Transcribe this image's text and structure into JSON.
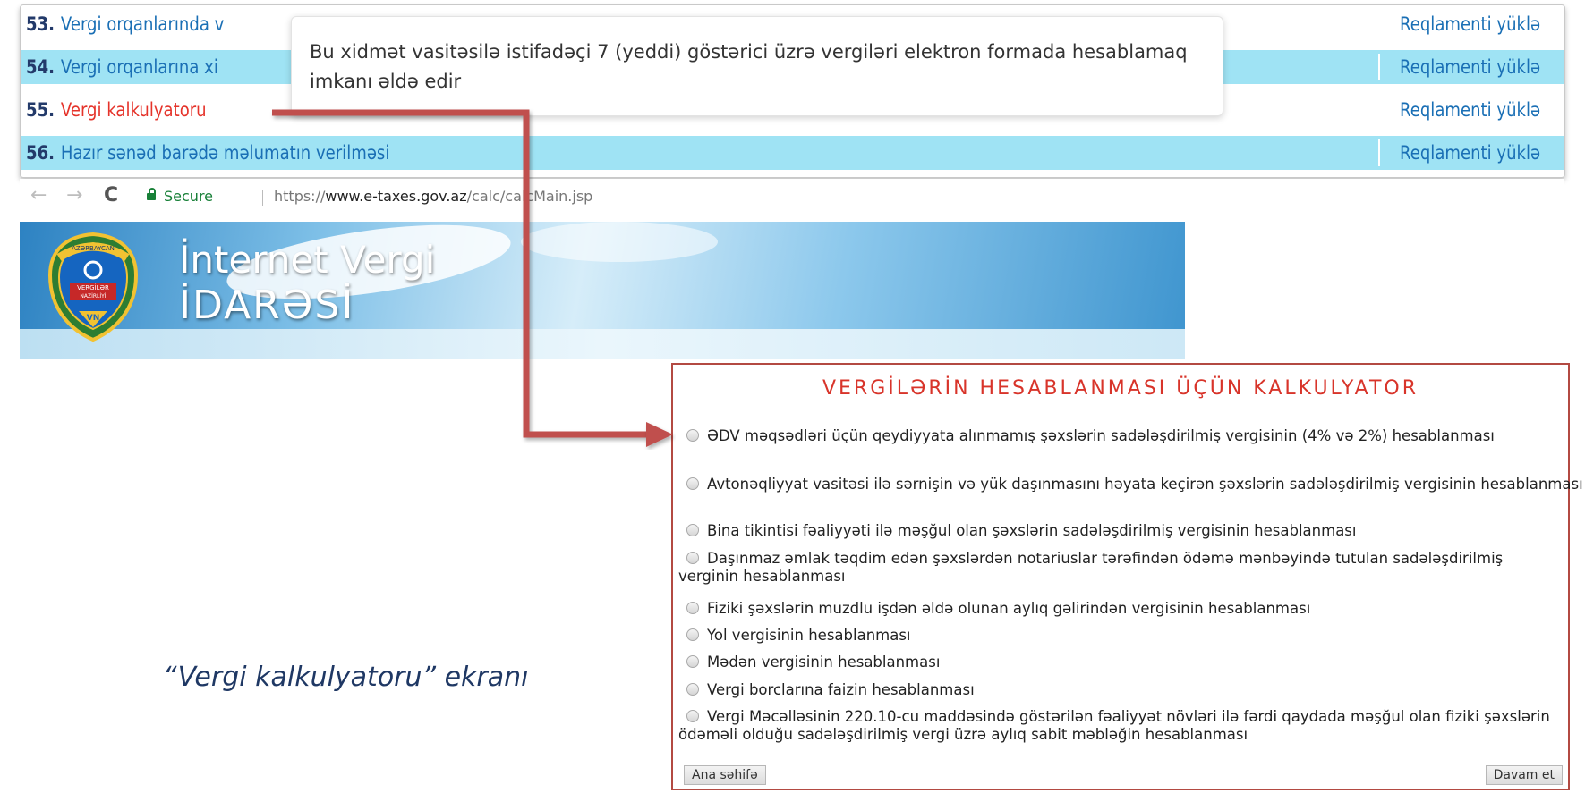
{
  "services": [
    {
      "number": "53.",
      "title": "Vergi orqanlarında v",
      "link": "Reqlamenti yüklə"
    },
    {
      "number": "54.",
      "title": "Vergi orqanlarına xi",
      "link": "Reqlamenti yüklə"
    },
    {
      "number": "55.",
      "title": "Vergi kalkulyatoru",
      "link": "Reqlamenti yüklə"
    },
    {
      "number": "56.",
      "title": "Hazır sənəd barədə məlumatın verilməsi",
      "link": "Reqlamenti yüklə"
    }
  ],
  "tooltip": {
    "text": "Bu xidmət vasitəsilə istifadəçi 7 (yeddi) göstərici üzrə vergiləri elektron formada hesablamaq imkanı əldə edir"
  },
  "browser": {
    "secure_label": "Secure",
    "url_scheme": "https://",
    "url_domain": "www.e-taxes.gov.az",
    "url_path": "/calc/calcMain.jsp"
  },
  "banner": {
    "title": "İnternet Vergi",
    "subtitle": "İDARƏSİ",
    "emblem_top": "AZƏRBAYCAN",
    "emblem_mid1": "VERGİLƏR",
    "emblem_mid2": "NAZİRLİYİ",
    "emblem_bottom": "VN"
  },
  "calculator": {
    "title": "VERGİLƏRİN HESABLANMASI ÜÇÜN KALKULYATOR",
    "options": [
      "ƏDV məqsədləri üçün qeydiyyata alınmamış şəxslərin sadələşdirilmiş vergisinin (4% və 2%) hesablanması",
      "Avtonəqliyyat vasitəsi ilə sərnişin və yük daşınmasını həyata keçirən şəxslərin sadələşdirilmiş vergisinin hesablanması",
      "Bina tikintisi fəaliyyəti ilə məşğul olan şəxslərin sadələşdirilmiş vergisinin hesablanması",
      "Daşınmaz əmlak təqdim edən şəxslərdən notariuslar tərəfindən ödəmə mənbəyində tutulan sadələşdirilmiş verginin hesablanması",
      "Fiziki şəxslərin muzdlu işdən əldə olunan aylıq gəlirindən vergisinin hesablanması",
      "Yol vergisinin hesablanması",
      "Mədən vergisinin hesablanması",
      "Vergi borclarına faizin hesablanması",
      "Vergi Məcəlləsinin 220.10-cu maddəsində göstərilən fəaliyyət növləri ilə fərdi qaydada məşğul olan fiziki şəxslərin ödəməli olduğu sadələşdirilmiş vergi üzrə aylıq sabit məbləğin hesablanması"
    ],
    "home_button": "Ana səhifə",
    "continue_button": "Davam et"
  },
  "caption": "“Vergi kalkulyatoru” ekranı",
  "colors": {
    "accent_red": "#d8342a",
    "link_blue": "#1a6fb5",
    "row_highlight": "#9fe3f4",
    "arrow": "#c0504d"
  }
}
